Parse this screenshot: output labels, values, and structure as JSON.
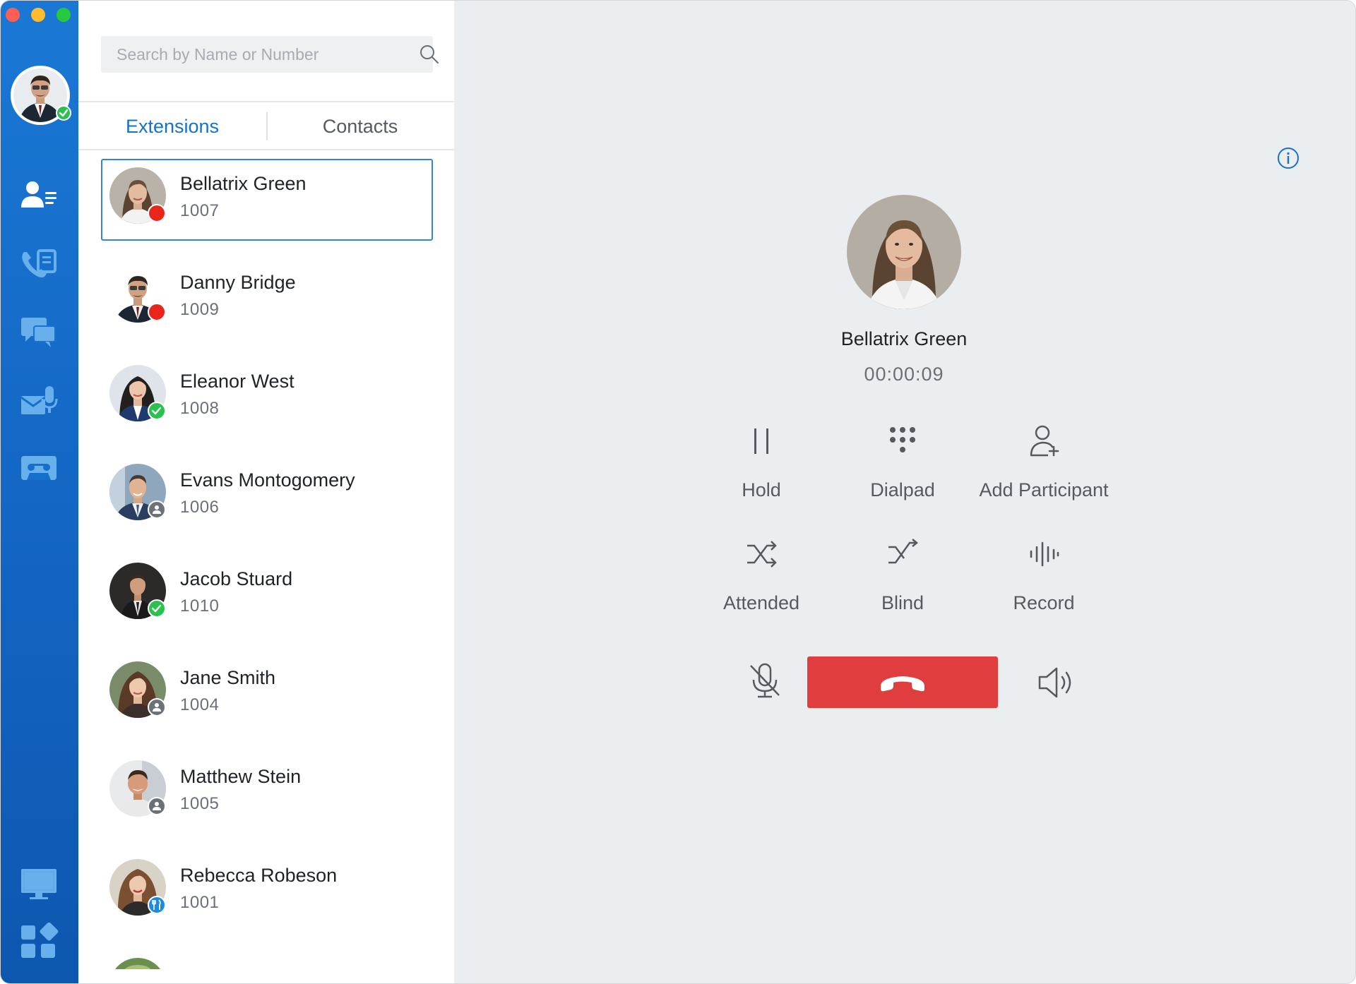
{
  "search": {
    "placeholder": "Search by Name or Number"
  },
  "tabs": [
    {
      "label": "Extensions",
      "active": true
    },
    {
      "label": "Contacts",
      "active": false
    }
  ],
  "nav": {
    "items": [
      {
        "icon": "contacts-icon"
      },
      {
        "icon": "call-log-icon"
      },
      {
        "icon": "chat-icon"
      },
      {
        "icon": "voicemail-icon"
      },
      {
        "icon": "recording-icon"
      }
    ],
    "bottom": [
      {
        "icon": "monitor-icon"
      },
      {
        "icon": "apps-grid-icon"
      }
    ]
  },
  "contacts": [
    {
      "name": "Bellatrix Green",
      "ext": "1007",
      "status": "busy",
      "selected": true
    },
    {
      "name": "Danny Bridge",
      "ext": "1009",
      "status": "busy"
    },
    {
      "name": "Eleanor West",
      "ext": "1008",
      "status": "online"
    },
    {
      "name": "Evans Montogomery",
      "ext": "1006",
      "status": "offline"
    },
    {
      "name": "Jacob Stuard",
      "ext": "1010",
      "status": "online"
    },
    {
      "name": "Jane Smith",
      "ext": "1004",
      "status": "offline"
    },
    {
      "name": "Matthew Stein",
      "ext": "1005",
      "status": "offline"
    },
    {
      "name": "Rebecca Robeson",
      "ext": "1001",
      "status": "meal"
    }
  ],
  "call": {
    "name": "Bellatrix Green",
    "timer": "00:00:09",
    "actions": [
      {
        "label": "Hold",
        "icon": "pause-icon"
      },
      {
        "label": "Dialpad",
        "icon": "dialpad-icon"
      },
      {
        "label": "Add Participant",
        "icon": "add-participant-icon"
      },
      {
        "label": "Attended",
        "icon": "attended-transfer-icon"
      },
      {
        "label": "Blind",
        "icon": "blind-transfer-icon"
      },
      {
        "label": "Record",
        "icon": "record-icon"
      }
    ]
  },
  "colors": {
    "accent": "#1572c9",
    "hangup": "#e03d3f",
    "busy": "#e8261c",
    "online": "#2ac150",
    "offline": "#6c7178",
    "meal": "#1c89e6"
  }
}
